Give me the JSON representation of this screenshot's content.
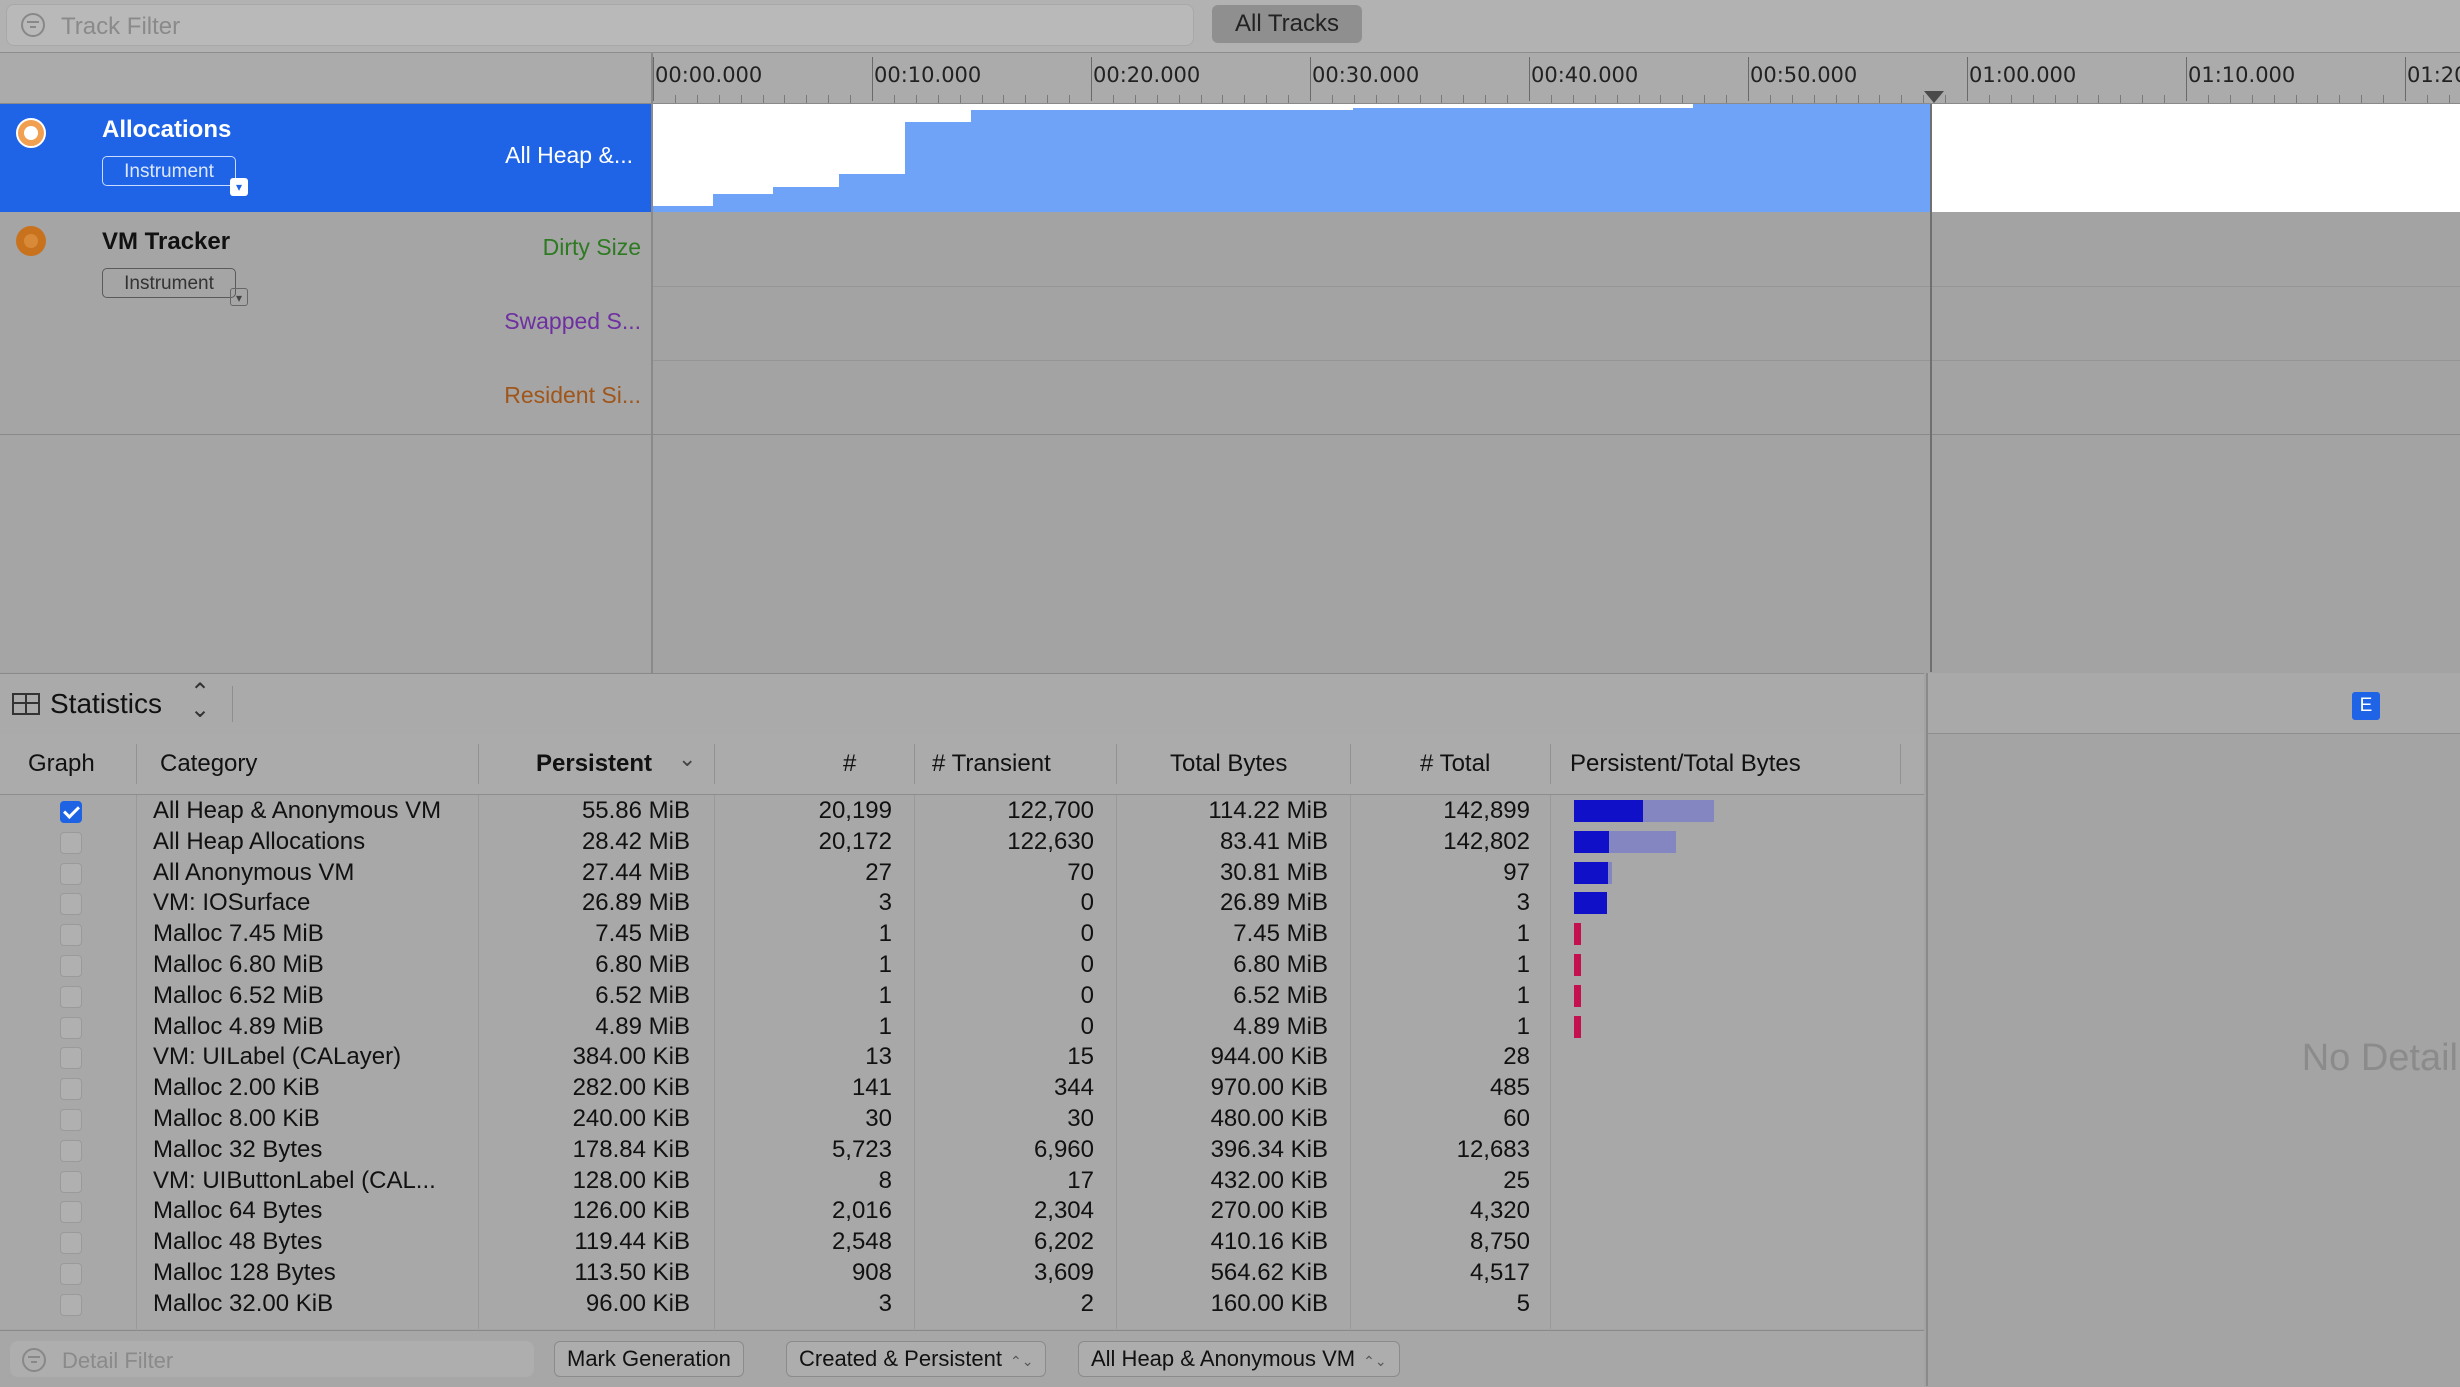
{
  "top_bar": {
    "track_filter_placeholder": "Track Filter",
    "all_tracks_label": "All Tracks"
  },
  "ruler": {
    "ticks": [
      "00:00.000",
      "00:10.000",
      "00:20.000",
      "00:30.000",
      "00:40.000",
      "00:50.000",
      "01:00.000",
      "01:10.000",
      "01:20"
    ]
  },
  "tracks": [
    {
      "title": "Allocations",
      "instrument_label": "Instrument",
      "series_labels": [
        "All Heap &..."
      ],
      "selected": true
    },
    {
      "title": "VM Tracker",
      "instrument_label": "Instrument",
      "series_labels": [
        "Dirty Size",
        "Swapped S...",
        "Resident Si..."
      ],
      "series_colors": [
        "#2e7a22",
        "#6e2fa0",
        "#a0561a"
      ]
    }
  ],
  "statistics": {
    "view_label": "Statistics",
    "columns": [
      "Graph",
      "Category",
      "Persistent",
      "#",
      "# Transient",
      "Total Bytes",
      "# Total",
      "Persistent/Total Bytes"
    ],
    "sort_indicator": "⌄",
    "rows": [
      {
        "graph": true,
        "category": "All Heap & Anonymous VM",
        "persistent": "55.86 MiB",
        "count": "20,199",
        "transient": "122,700",
        "total_bytes": "114.22 MiB",
        "total": "142,899",
        "pers_frac": 0.49
      },
      {
        "graph": false,
        "category": "All Heap Allocations",
        "persistent": "28.42 MiB",
        "count": "20,172",
        "transient": "122,630",
        "total_bytes": "83.41 MiB",
        "total": "142,802",
        "pers_frac": 0.34
      },
      {
        "graph": false,
        "category": "All Anonymous VM",
        "persistent": "27.44 MiB",
        "count": "27",
        "transient": "70",
        "total_bytes": "30.81 MiB",
        "total": "97",
        "pers_frac": 0.89
      },
      {
        "graph": false,
        "category": "VM: IOSurface",
        "persistent": "26.89 MiB",
        "count": "3",
        "transient": "0",
        "total_bytes": "26.89 MiB",
        "total": "3",
        "pers_frac": 1.0
      },
      {
        "graph": false,
        "category": "Malloc 7.45 MiB",
        "persistent": "7.45 MiB",
        "count": "1",
        "transient": "0",
        "total_bytes": "7.45 MiB",
        "total": "1",
        "pers_frac": 1.0
      },
      {
        "graph": false,
        "category": "Malloc 6.80 MiB",
        "persistent": "6.80 MiB",
        "count": "1",
        "transient": "0",
        "total_bytes": "6.80 MiB",
        "total": "1",
        "pers_frac": 1.0
      },
      {
        "graph": false,
        "category": "Malloc 6.52 MiB",
        "persistent": "6.52 MiB",
        "count": "1",
        "transient": "0",
        "total_bytes": "6.52 MiB",
        "total": "1",
        "pers_frac": 1.0
      },
      {
        "graph": false,
        "category": "Malloc 4.89 MiB",
        "persistent": "4.89 MiB",
        "count": "1",
        "transient": "0",
        "total_bytes": "4.89 MiB",
        "total": "1",
        "pers_frac": 1.0
      },
      {
        "graph": false,
        "category": "VM: UILabel (CALayer)",
        "persistent": "384.00 KiB",
        "count": "13",
        "transient": "15",
        "total_bytes": "944.00 KiB",
        "total": "28"
      },
      {
        "graph": false,
        "category": "Malloc 2.00 KiB",
        "persistent": "282.00 KiB",
        "count": "141",
        "transient": "344",
        "total_bytes": "970.00 KiB",
        "total": "485"
      },
      {
        "graph": false,
        "category": "Malloc 8.00 KiB",
        "persistent": "240.00 KiB",
        "count": "30",
        "transient": "30",
        "total_bytes": "480.00 KiB",
        "total": "60"
      },
      {
        "graph": false,
        "category": "Malloc 32 Bytes",
        "persistent": "178.84 KiB",
        "count": "5,723",
        "transient": "6,960",
        "total_bytes": "396.34 KiB",
        "total": "12,683"
      },
      {
        "graph": false,
        "category": "VM: UIButtonLabel (CAL...",
        "persistent": "128.00 KiB",
        "count": "8",
        "transient": "17",
        "total_bytes": "432.00 KiB",
        "total": "25"
      },
      {
        "graph": false,
        "category": "Malloc 64 Bytes",
        "persistent": "126.00 KiB",
        "count": "2,016",
        "transient": "2,304",
        "total_bytes": "270.00 KiB",
        "total": "4,320"
      },
      {
        "graph": false,
        "category": "Malloc 48 Bytes",
        "persistent": "119.44 KiB",
        "count": "2,548",
        "transient": "6,202",
        "total_bytes": "410.16 KiB",
        "total": "8,750"
      },
      {
        "graph": false,
        "category": "Malloc 128 Bytes",
        "persistent": "113.50 KiB",
        "count": "908",
        "transient": "3,609",
        "total_bytes": "564.62 KiB",
        "total": "4,517"
      },
      {
        "graph": false,
        "category": "Malloc 32.00 KiB",
        "persistent": "96.00 KiB",
        "count": "3",
        "transient": "2",
        "total_bytes": "160.00 KiB",
        "total": "5"
      }
    ]
  },
  "bottom_bar": {
    "detail_filter_placeholder": "Detail Filter",
    "mark_generation_label": "Mark Generation",
    "lifespan_select": "Created & Persistent",
    "allocation_type_select": "All Heap & Anonymous VM"
  },
  "detail_pane": {
    "badge": "E",
    "empty_text": "No Detail"
  },
  "colors": {
    "selection_blue": "#1f63e6",
    "graph_fill": "#6fa3f7",
    "bar_persistent": "#1010c8",
    "bar_total": "#8486c1",
    "bar_small": "#c4104e"
  }
}
